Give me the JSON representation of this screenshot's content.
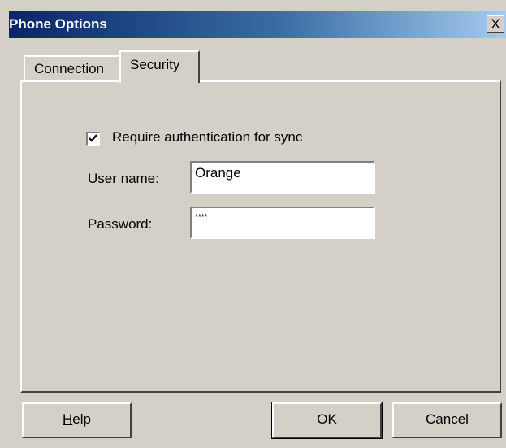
{
  "window": {
    "title": "Phone Options",
    "close_label": "X"
  },
  "tabs": [
    {
      "label": "Connection",
      "active": false
    },
    {
      "label": "Security",
      "active": true
    }
  ],
  "security": {
    "require_auth": {
      "label": "Require authentication for sync",
      "checked": true
    },
    "user_name": {
      "label": "User name:",
      "value": "Orange"
    },
    "password": {
      "label": "Password:",
      "value": "****"
    }
  },
  "buttons": {
    "help": "Help",
    "ok": "OK",
    "cancel": "Cancel"
  }
}
